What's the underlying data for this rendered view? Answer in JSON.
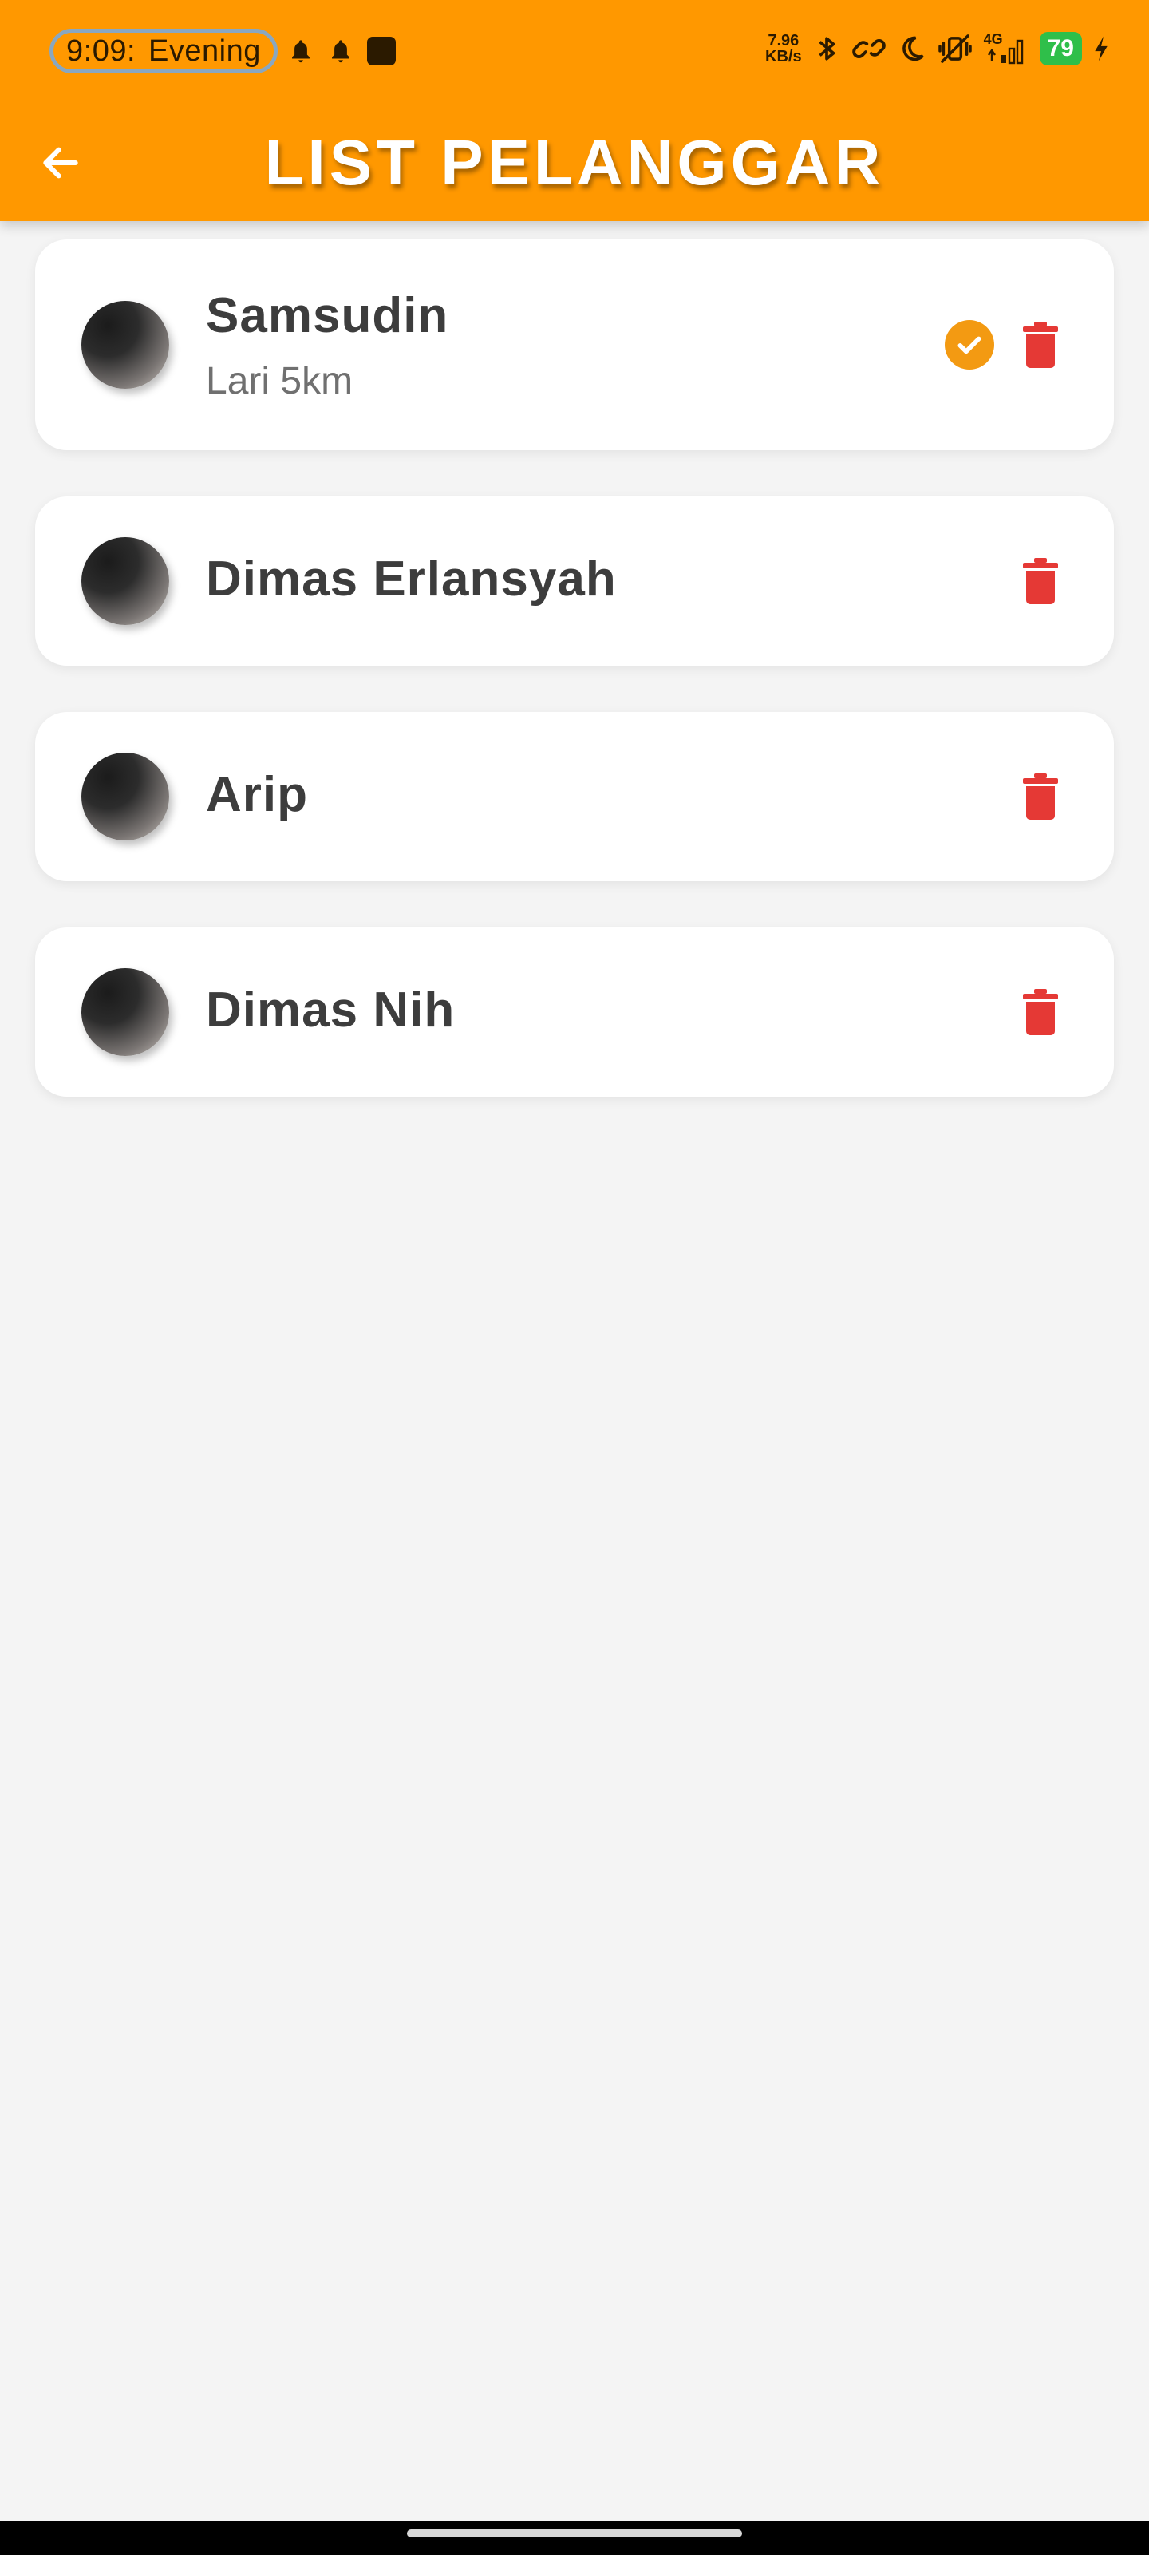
{
  "status_bar": {
    "time": "9:09:",
    "label": "Evening",
    "net_speed_value": "7.96",
    "net_speed_unit": "KB/s",
    "network": "4G",
    "battery": "79"
  },
  "app_bar": {
    "title": "LIST PELANGGAR"
  },
  "items": [
    {
      "name": "Samsudin",
      "subtitle": "Lari 5km",
      "completed": true
    },
    {
      "name": "Dimas Erlansyah",
      "subtitle": "",
      "completed": false
    },
    {
      "name": "Arip",
      "subtitle": "",
      "completed": false
    },
    {
      "name": "Dimas Nih",
      "subtitle": "",
      "completed": false
    }
  ],
  "colors": {
    "primary": "#ff9800",
    "check": "#f39a12",
    "delete": "#e53935",
    "background": "#f4f4f4"
  },
  "icons": {
    "back": "arrow-left-icon",
    "check": "check-circle-icon",
    "delete": "trash-icon"
  }
}
